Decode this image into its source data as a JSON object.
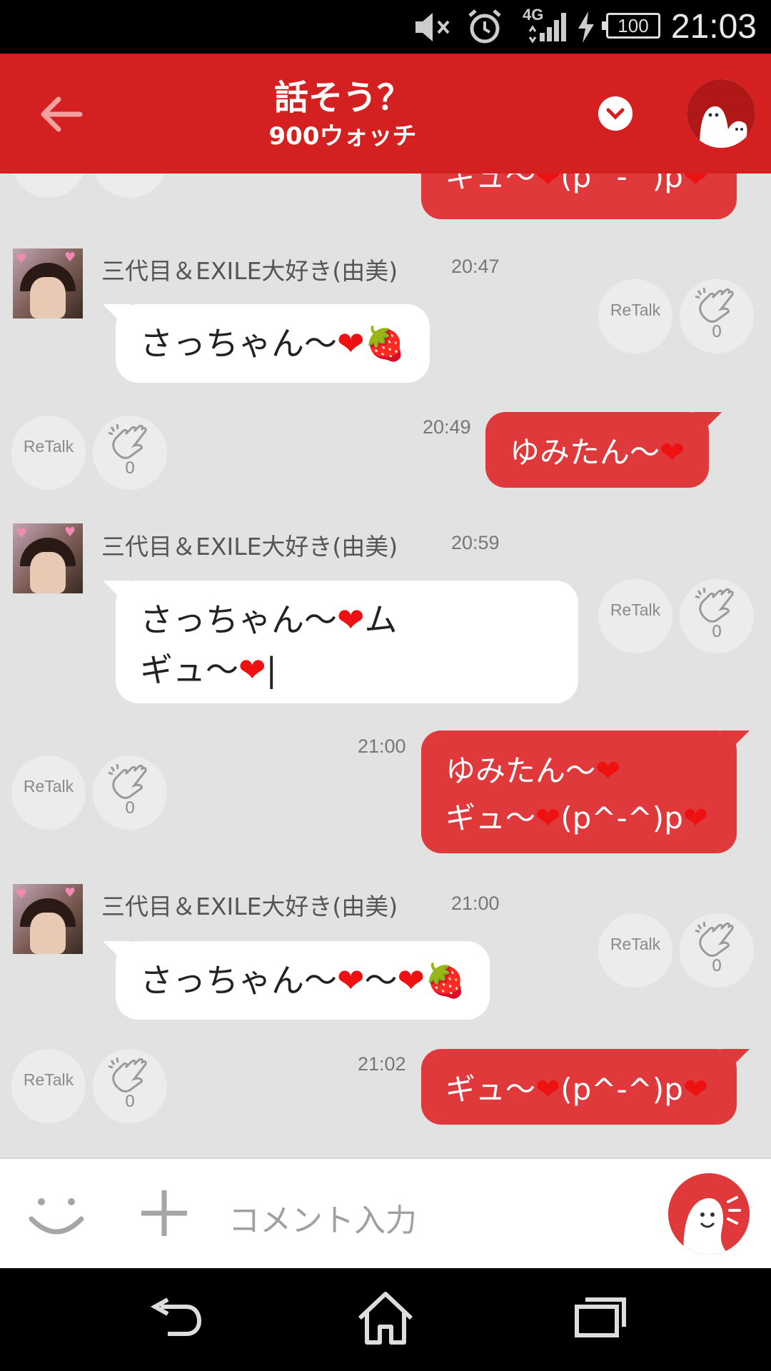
{
  "status_bar": {
    "time": "21:03",
    "battery": "100",
    "network": "4G",
    "icons": [
      "mute-icon",
      "alarm-icon",
      "signal-icon",
      "charging-icon",
      "battery-icon"
    ]
  },
  "header": {
    "title": "話そう？",
    "subtitle": "900ウォッチ",
    "back_icon": "arrow-left-icon",
    "dropdown_icon": "chevron-down-icon",
    "accent_color": "#d42020"
  },
  "chat": {
    "retalk_label": "ReTalk",
    "top_partial": {
      "text": "ギュ〜",
      "tail": "(p^-^)p"
    },
    "messages": [
      {
        "direction": "in",
        "sender": "三代目＆EXILE大好き(由美)",
        "time": "20:47",
        "text": "さっちゃん〜",
        "clap_count": "0"
      },
      {
        "direction": "out",
        "time": "20:49",
        "text": "ゆみたん〜",
        "clap_count": "0"
      },
      {
        "direction": "in",
        "sender": "三代目＆EXILE大好き(由美)",
        "time": "20:59",
        "line1": "さっちゃん〜",
        "line1_tail": "ム",
        "line2": "ギュ〜",
        "line2_tail": "|",
        "clap_count": "0"
      },
      {
        "direction": "out",
        "time": "21:00",
        "line1": "ゆみたん〜",
        "line2": "ギュ〜",
        "line2_tail": "(p^-^)p",
        "clap_count": "0"
      },
      {
        "direction": "in",
        "sender": "三代目＆EXILE大好き(由美)",
        "time": "21:00",
        "text": "さっちゃん〜",
        "mid": "〜",
        "clap_count": "0"
      },
      {
        "direction": "out",
        "time": "21:02",
        "text": "ギュ〜",
        "tail": "(p^-^)p",
        "clap_count": "0"
      }
    ],
    "bubble_out_color": "#e0393b",
    "background_color": "#e2e2e2"
  },
  "input_bar": {
    "placeholder": "コメント入力",
    "emoji_icon": "smiley-icon",
    "add_icon": "plus-icon",
    "send_icon": "talk-character-icon"
  },
  "nav_bar": {
    "icons": [
      "back-nav-icon",
      "home-icon",
      "recent-apps-icon"
    ]
  }
}
